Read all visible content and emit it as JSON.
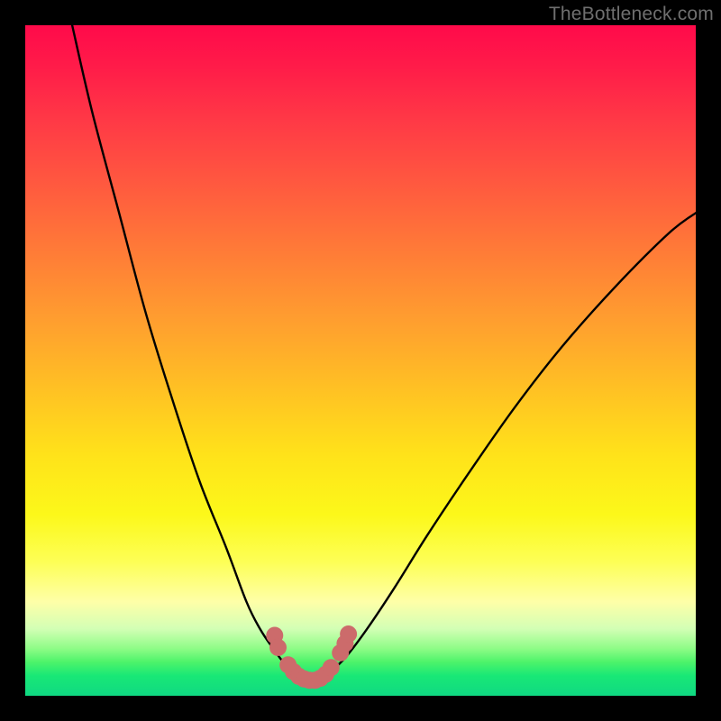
{
  "watermark": "TheBottleneck.com",
  "chart_data": {
    "type": "line",
    "title": "",
    "xlabel": "",
    "ylabel": "",
    "xlim": [
      0,
      100
    ],
    "ylim": [
      0,
      100
    ],
    "series": [
      {
        "name": "curve-left",
        "x": [
          7,
          10,
          14,
          18,
          22,
          26,
          30,
          33,
          35,
          37,
          38.5,
          40,
          41.5
        ],
        "y": [
          100,
          87,
          72,
          57,
          44,
          32,
          22,
          14,
          10,
          7,
          5,
          3.5,
          2.5
        ]
      },
      {
        "name": "curve-right",
        "x": [
          44,
          46,
          48,
          51,
          55,
          60,
          66,
          73,
          80,
          88,
          96,
          100
        ],
        "y": [
          2.5,
          4,
          6,
          10,
          16,
          24,
          33,
          43,
          52,
          61,
          69,
          72
        ]
      },
      {
        "name": "valley-floor",
        "x": [
          41.5,
          42.5,
          43,
          43.5,
          44
        ],
        "y": [
          2.5,
          2.2,
          2.2,
          2.2,
          2.5
        ]
      }
    ],
    "markers": {
      "name": "highlight-dots",
      "color": "#cc6b6b",
      "points": [
        {
          "x": 37.2,
          "y": 9.0
        },
        {
          "x": 37.7,
          "y": 7.2
        },
        {
          "x": 39.2,
          "y": 4.6
        },
        {
          "x": 40.0,
          "y": 3.6
        },
        {
          "x": 40.8,
          "y": 2.9
        },
        {
          "x": 41.6,
          "y": 2.5
        },
        {
          "x": 42.4,
          "y": 2.3
        },
        {
          "x": 43.2,
          "y": 2.3
        },
        {
          "x": 44.0,
          "y": 2.6
        },
        {
          "x": 44.8,
          "y": 3.2
        },
        {
          "x": 45.6,
          "y": 4.2
        },
        {
          "x": 47.0,
          "y": 6.4
        },
        {
          "x": 47.7,
          "y": 7.8
        },
        {
          "x": 48.2,
          "y": 9.2
        }
      ]
    }
  }
}
